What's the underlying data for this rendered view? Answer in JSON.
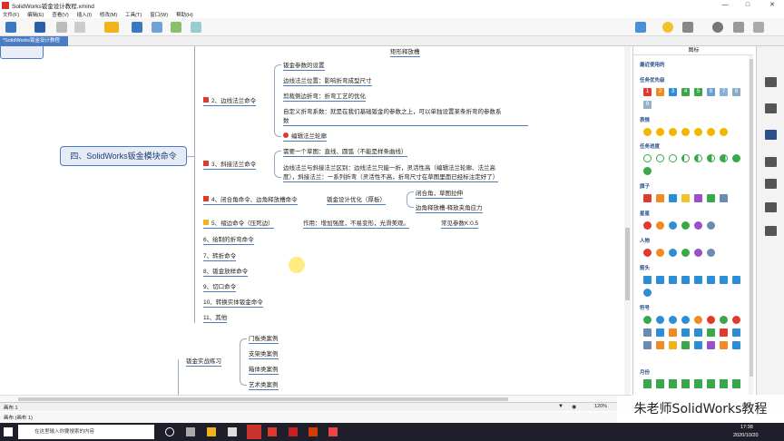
{
  "window": {
    "title": "SolidWorks钣金设计教程.xmind"
  },
  "menu": [
    "文件(F)",
    "编辑(E)",
    "查看(V)",
    "插入(I)",
    "修改(M)",
    "工具(T)",
    "窗口(W)",
    "帮助(H)"
  ],
  "tab": {
    "label": "*SolidWorks钣金设计教程"
  },
  "mindmap": {
    "top_partial": "矩形释放槽",
    "central": "四、SolidWorks钣金模块命令",
    "b2": "2、边线法兰命令",
    "b2_items": [
      "钣金参数的设置",
      "边线法兰位置：影响折弯成型尺寸",
      "剪裁侧边折弯：折弯工艺的优化",
      "自定义折弯系数：就是在我们基础钣金的参数之上，可以单独设置某条折弯的参数系",
      "数",
      "编辑法兰轮廓"
    ],
    "b3": "3、斜接法兰命令",
    "b3_items": [
      "需要一个草图：直线、圆弧（不能是样条曲线）",
      "边线法兰与斜接法兰区别：边线法兰只能一折，灵活性高（编辑法兰轮廓、法兰高",
      "度），斜接法兰：一系列折弯（灵活性不高，折弯尺寸在草图里面已经标注定好了）"
    ],
    "b4": "4、闭合角命令、边角释放槽命令",
    "b4_mid": "钣金设计优化（厚板）",
    "b4_items": [
      "闭合角，草图拉伸",
      "边角释放槽-释放夹角应力"
    ],
    "b5": "5、褶边命令（压死边）",
    "b5_mid": "作用：增加强度，不易变形，光滑美观。",
    "b5_end": "常见参数K:0.5",
    "others": [
      "6、绘制的折弯命令",
      "7、转折命令",
      "8、钣金放样命令",
      "9、切口命令",
      "10、转换实体钣金命令",
      "11、其他"
    ],
    "practice": "钣金实战练习",
    "practice_items": [
      "门板类案例",
      "支架类案例",
      "箱体类案例",
      "艺术类案例"
    ]
  },
  "panel": {
    "title": "图标",
    "sections": [
      "最近使用的",
      "任务优先级",
      "表情",
      "任务进度",
      "旗子",
      "星星",
      "人物",
      "箭头",
      "符号",
      "月份"
    ],
    "priority": [
      "1",
      "2",
      "3",
      "4",
      "5",
      "6",
      "7",
      "8",
      "9"
    ]
  },
  "status": {
    "sheet": "画布 1",
    "zoom": "120%",
    "bottom": "画布 (画布 1)"
  },
  "taskbar": {
    "search": "在这里输入你要搜索的内容",
    "time": "17:38",
    "date": "2020/10/20"
  },
  "watermark": "朱老师SolidWorks教程",
  "colors": {
    "accent": "#4a7cc4",
    "flag": "#e03a2e",
    "taskbar": "#1f1f2c"
  }
}
